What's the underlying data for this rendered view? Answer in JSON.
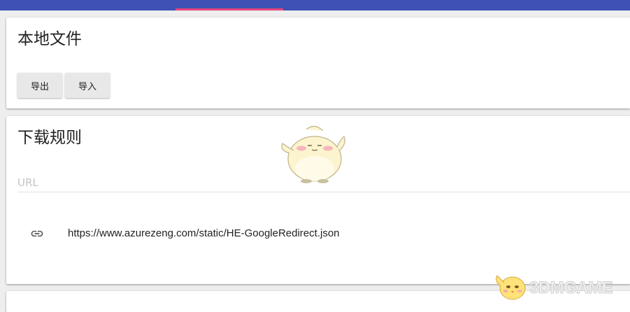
{
  "local_files": {
    "title": "本地文件",
    "export_label": "导出",
    "import_label": "导入"
  },
  "download_rules": {
    "title": "下载规则",
    "url_placeholder": "URL",
    "url_value": "",
    "rules": [
      {
        "icon": "link-icon",
        "url": "https://www.azurezeng.com/static/HE-GoogleRedirect.json"
      }
    ]
  },
  "watermark": {
    "text": "3DMGAME"
  },
  "colors": {
    "app_bar": "#3f51b5",
    "tab_indicator": "#e8467c",
    "background": "#eeeeee"
  }
}
